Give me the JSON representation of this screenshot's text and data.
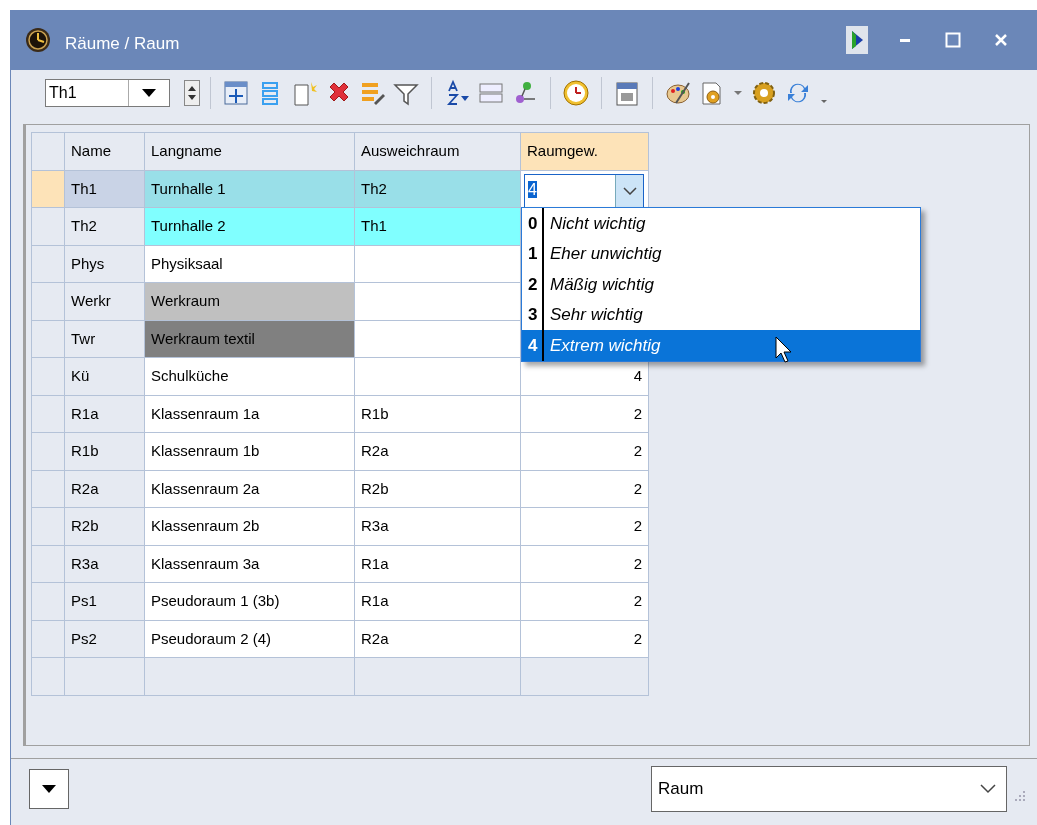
{
  "window": {
    "title": "Räume / Raum"
  },
  "toolbar": {
    "selector_value": "Th1"
  },
  "table": {
    "columns": [
      {
        "label": "Name",
        "selected": false
      },
      {
        "label": "Langname",
        "selected": false
      },
      {
        "label": "Ausweichraum",
        "selected": false
      },
      {
        "label": "Raumgew.",
        "selected": true
      }
    ],
    "rows": [
      {
        "name": "Th1",
        "langname": "Turnhalle 1",
        "color": "#99dfe8",
        "ausweichraum": "Th2",
        "ausweichraum_tinted": true,
        "selected": true
      },
      {
        "name": "Th2",
        "langname": "Turnhalle 2",
        "color": "#80ffff",
        "ausweichraum": "Th1",
        "ausweichraum_tinted": true,
        "selected": false
      },
      {
        "name": "Phys",
        "langname": "Physiksaal",
        "color": "#ffffff",
        "selected": false
      },
      {
        "name": "Werkr",
        "langname": "Werkraum",
        "color": "#c0c0c0",
        "selected": false
      },
      {
        "name": "Twr",
        "langname": "Werkraum textil",
        "color": "#808080",
        "selected": false
      },
      {
        "name": "Kü",
        "langname": "Schulküche",
        "color": "#ffffff",
        "raumgew": "4",
        "selected": false
      },
      {
        "name": "R1a",
        "langname": "Klassenraum 1a",
        "color": "#ffffff",
        "ausweichraum": "R1b",
        "raumgew": "2",
        "selected": false
      },
      {
        "name": "R1b",
        "langname": "Klassenraum 1b",
        "color": "#ffffff",
        "ausweichraum": "R2a",
        "raumgew": "2",
        "selected": false
      },
      {
        "name": "R2a",
        "langname": "Klassenraum 2a",
        "color": "#ffffff",
        "ausweichraum": "R2b",
        "raumgew": "2",
        "selected": false
      },
      {
        "name": "R2b",
        "langname": "Klassenraum 2b",
        "color": "#ffffff",
        "ausweichraum": "R3a",
        "raumgew": "2",
        "selected": false
      },
      {
        "name": "R3a",
        "langname": "Klassenraum 3a",
        "color": "#ffffff",
        "ausweichraum": "R1a",
        "raumgew": "2",
        "selected": false
      },
      {
        "name": "Ps1",
        "langname": "Pseudoraum 1 (3b)",
        "color": "#ffffff",
        "ausweichraum": "R1a",
        "raumgew": "2",
        "selected": false
      },
      {
        "name": "Ps2",
        "langname": "Pseudoraum 2 (4)",
        "color": "#ffffff",
        "ausweichraum": "R2a",
        "raumgew": "2",
        "selected": false
      }
    ],
    "editor": {
      "value": "4"
    },
    "dropdown": {
      "options": [
        {
          "key": "0",
          "label": "Nicht wichtig",
          "selected": false
        },
        {
          "key": "1",
          "label": "Eher unwichtig",
          "selected": false
        },
        {
          "key": "2",
          "label": "Mäßig wichtig",
          "selected": false
        },
        {
          "key": "3",
          "label": "Sehr wichtig",
          "selected": false
        },
        {
          "key": "4",
          "label": "Extrem wichtig",
          "selected": true
        }
      ]
    }
  },
  "footer": {
    "view_select": "Raum"
  }
}
